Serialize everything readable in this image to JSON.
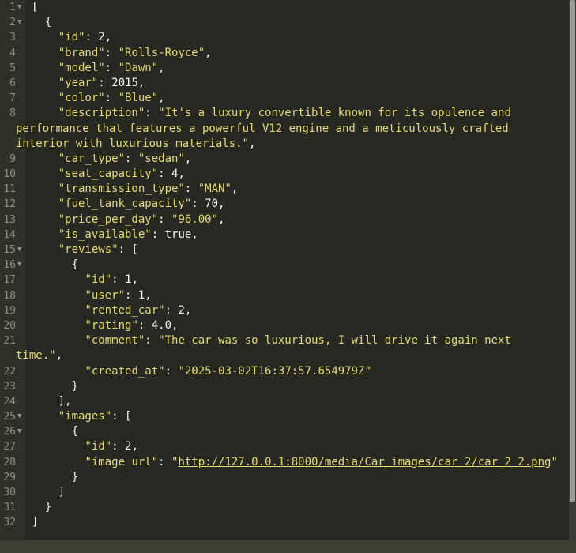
{
  "editor": {
    "lines": [
      {
        "n": "1",
        "fold": true,
        "segs": [
          {
            "t": "["
          }
        ]
      },
      {
        "n": "2",
        "fold": true,
        "segs": [
          {
            "t": "  {"
          }
        ]
      },
      {
        "n": "3",
        "segs": [
          {
            "t": "    "
          },
          {
            "t": "\"id\"",
            "c": "s"
          },
          {
            "t": ": 2,"
          }
        ]
      },
      {
        "n": "4",
        "segs": [
          {
            "t": "    "
          },
          {
            "t": "\"brand\"",
            "c": "s"
          },
          {
            "t": ": "
          },
          {
            "t": "\"Rolls-Royce\"",
            "c": "s"
          },
          {
            "t": ","
          }
        ]
      },
      {
        "n": "5",
        "segs": [
          {
            "t": "    "
          },
          {
            "t": "\"model\"",
            "c": "s"
          },
          {
            "t": ": "
          },
          {
            "t": "\"Dawn\"",
            "c": "s"
          },
          {
            "t": ","
          }
        ]
      },
      {
        "n": "6",
        "segs": [
          {
            "t": "    "
          },
          {
            "t": "\"year\"",
            "c": "s"
          },
          {
            "t": ": 2015,"
          }
        ]
      },
      {
        "n": "7",
        "segs": [
          {
            "t": "    "
          },
          {
            "t": "\"color\"",
            "c": "s"
          },
          {
            "t": ": "
          },
          {
            "t": "\"Blue\"",
            "c": "s"
          },
          {
            "t": ","
          }
        ]
      },
      {
        "n": "8",
        "segs": [
          {
            "t": "    "
          },
          {
            "t": "\"description\"",
            "c": "s"
          },
          {
            "t": ": "
          },
          {
            "t": "\"It's a luxury convertible known for its opulence and",
            "c": "s"
          }
        ]
      },
      {
        "n": "",
        "wrap": true,
        "segs": [
          {
            "t": "performance that features a powerful V12 engine and a meticulously crafted",
            "c": "s"
          }
        ]
      },
      {
        "n": "",
        "wrap": true,
        "segs": [
          {
            "t": "interior with luxurious materials.\"",
            "c": "s"
          },
          {
            "t": ","
          }
        ]
      },
      {
        "n": "9",
        "segs": [
          {
            "t": "    "
          },
          {
            "t": "\"car_type\"",
            "c": "s"
          },
          {
            "t": ": "
          },
          {
            "t": "\"sedan\"",
            "c": "s"
          },
          {
            "t": ","
          }
        ]
      },
      {
        "n": "10",
        "segs": [
          {
            "t": "    "
          },
          {
            "t": "\"seat_capacity\"",
            "c": "s"
          },
          {
            "t": ": 4,"
          }
        ]
      },
      {
        "n": "11",
        "segs": [
          {
            "t": "    "
          },
          {
            "t": "\"transmission_type\"",
            "c": "s"
          },
          {
            "t": ": "
          },
          {
            "t": "\"MAN\"",
            "c": "s"
          },
          {
            "t": ","
          }
        ]
      },
      {
        "n": "12",
        "segs": [
          {
            "t": "    "
          },
          {
            "t": "\"fuel_tank_capacity\"",
            "c": "s"
          },
          {
            "t": ": 70,"
          }
        ]
      },
      {
        "n": "13",
        "segs": [
          {
            "t": "    "
          },
          {
            "t": "\"price_per_day\"",
            "c": "s"
          },
          {
            "t": ": "
          },
          {
            "t": "\"96.00\"",
            "c": "s"
          },
          {
            "t": ","
          }
        ]
      },
      {
        "n": "14",
        "segs": [
          {
            "t": "    "
          },
          {
            "t": "\"is_available\"",
            "c": "s"
          },
          {
            "t": ": true,"
          }
        ]
      },
      {
        "n": "15",
        "fold": true,
        "segs": [
          {
            "t": "    "
          },
          {
            "t": "\"reviews\"",
            "c": "s"
          },
          {
            "t": ": ["
          }
        ]
      },
      {
        "n": "16",
        "fold": true,
        "segs": [
          {
            "t": "      {"
          }
        ]
      },
      {
        "n": "17",
        "segs": [
          {
            "t": "        "
          },
          {
            "t": "\"id\"",
            "c": "s"
          },
          {
            "t": ": 1,"
          }
        ]
      },
      {
        "n": "18",
        "segs": [
          {
            "t": "        "
          },
          {
            "t": "\"user\"",
            "c": "s"
          },
          {
            "t": ": 1,"
          }
        ]
      },
      {
        "n": "19",
        "segs": [
          {
            "t": "        "
          },
          {
            "t": "\"rented_car\"",
            "c": "s"
          },
          {
            "t": ": 2,"
          }
        ]
      },
      {
        "n": "20",
        "segs": [
          {
            "t": "        "
          },
          {
            "t": "\"rating\"",
            "c": "s"
          },
          {
            "t": ": 4.0,"
          }
        ]
      },
      {
        "n": "21",
        "segs": [
          {
            "t": "        "
          },
          {
            "t": "\"comment\"",
            "c": "s"
          },
          {
            "t": ": "
          },
          {
            "t": "\"The car was so luxurious, I will drive it again next",
            "c": "s"
          }
        ]
      },
      {
        "n": "",
        "wrap": true,
        "segs": [
          {
            "t": "time.\"",
            "c": "s"
          },
          {
            "t": ","
          }
        ]
      },
      {
        "n": "22",
        "segs": [
          {
            "t": "        "
          },
          {
            "t": "\"created_at\"",
            "c": "s"
          },
          {
            "t": ": "
          },
          {
            "t": "\"2025-03-02T16:37:57.654979Z\"",
            "c": "s"
          }
        ]
      },
      {
        "n": "23",
        "segs": [
          {
            "t": "      }"
          }
        ]
      },
      {
        "n": "24",
        "segs": [
          {
            "t": "    ],"
          }
        ]
      },
      {
        "n": "25",
        "fold": true,
        "segs": [
          {
            "t": "    "
          },
          {
            "t": "\"images\"",
            "c": "s"
          },
          {
            "t": ": ["
          }
        ]
      },
      {
        "n": "26",
        "fold": true,
        "segs": [
          {
            "t": "      {"
          }
        ]
      },
      {
        "n": "27",
        "segs": [
          {
            "t": "        "
          },
          {
            "t": "\"id\"",
            "c": "s"
          },
          {
            "t": ": 2,"
          }
        ]
      },
      {
        "n": "28",
        "segs": [
          {
            "t": "        "
          },
          {
            "t": "\"image_url\"",
            "c": "s"
          },
          {
            "t": ": "
          },
          {
            "t": "\"",
            "c": "s"
          },
          {
            "t": "http://127.0.0.1:8000/media/Car_images/car_2/car_2_2.png",
            "c": "link"
          },
          {
            "t": "\"",
            "c": "s"
          }
        ]
      },
      {
        "n": "29",
        "segs": [
          {
            "t": "      }"
          }
        ]
      },
      {
        "n": "30",
        "segs": [
          {
            "t": "    ]"
          }
        ]
      },
      {
        "n": "31",
        "segs": [
          {
            "t": "  }"
          }
        ]
      },
      {
        "n": "32",
        "segs": [
          {
            "t": "]"
          }
        ]
      }
    ]
  },
  "icons": {
    "fold": "fold-arrow-icon"
  },
  "colors": {
    "background": "#272822",
    "string": "#e6db74",
    "text": "#f8f8f2",
    "line_number": "#8f908a"
  }
}
